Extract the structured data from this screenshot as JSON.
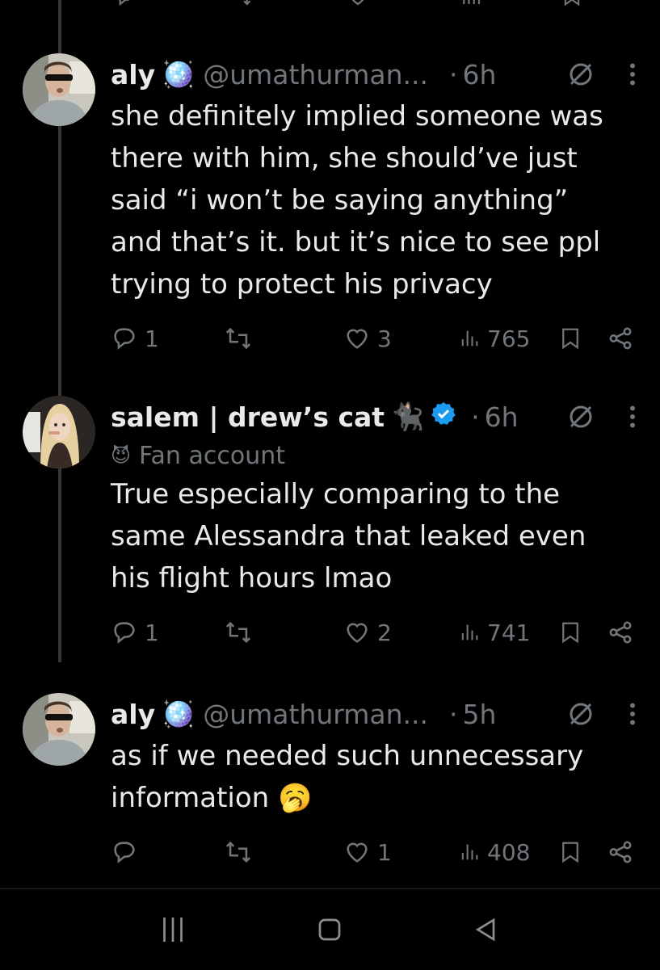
{
  "colors": {
    "background": "#000000",
    "text": "#e7e9ea",
    "muted": "#71767b",
    "verified": "#1d9bf0",
    "line": "#333639"
  },
  "tweets": [
    {
      "name": "aly",
      "name_emoji": "🪩",
      "handle": "@umathurman...",
      "dot": "·",
      "time": "6h",
      "body": [
        "she definitely implied someone was",
        "there with him, she should’ve just",
        "said “i won’t be saying anything”",
        "and that’s it. but it’s nice to see ppl",
        "trying to protect his privacy"
      ],
      "replies": "1",
      "retweets": "",
      "likes": "3",
      "views": "765"
    },
    {
      "name": "salem | drew’s cat",
      "name_emoji": "🐈‍⬛",
      "verified": true,
      "dot": "·",
      "time": "6h",
      "label_icon": "😈",
      "label": "Fan account",
      "body": [
        "True especially comparing to the",
        "same Alessandra that leaked even",
        "his flight hours lmao"
      ],
      "replies": "1",
      "retweets": "",
      "likes": "2",
      "views": "741"
    },
    {
      "name": "aly",
      "name_emoji": "🪩",
      "handle": "@umathurman...",
      "dot": "·",
      "time": "5h",
      "body": [
        "as if we needed such unnecessary",
        "information 🥱"
      ],
      "replies": "",
      "retweets": "",
      "likes": "1",
      "views": "408"
    }
  ],
  "icons": [
    "reply-icon",
    "retweet-icon",
    "like-icon",
    "views-icon",
    "bookmark-icon",
    "share-icon",
    "grok-icon",
    "more-icon",
    "nav-recents-icon",
    "nav-home-icon",
    "nav-back-icon"
  ]
}
